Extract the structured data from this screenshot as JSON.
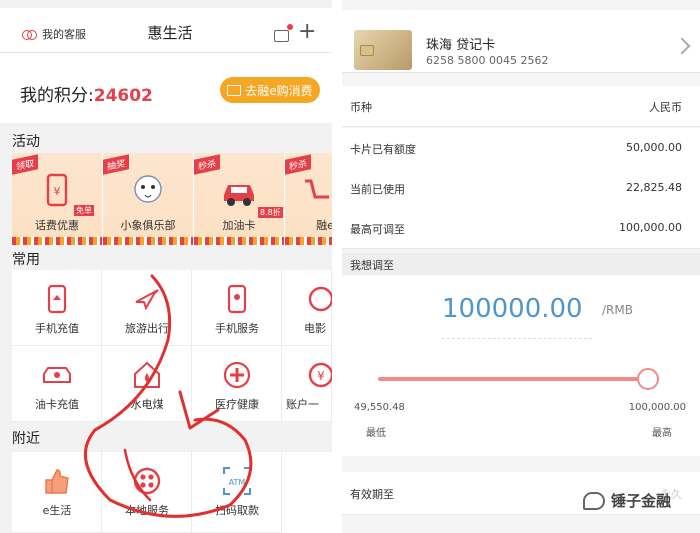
{
  "left": {
    "header": {
      "service": "我的客服",
      "title": "惠生活"
    },
    "points": {
      "label": "我的积分:",
      "value": "24602",
      "button": "去融e购消费"
    },
    "sections": {
      "activities": "活动",
      "common": "常用",
      "nearby": "附近"
    },
    "activities": [
      {
        "label": "话费优惠",
        "badge": "免单"
      },
      {
        "label": "小象俱乐部",
        "badge": ""
      },
      {
        "label": "加油卡",
        "badge": "8.8折"
      },
      {
        "label": "融e",
        "badge": ""
      }
    ],
    "common": [
      {
        "label": "手机充值",
        "icon": "phone-recharge-icon"
      },
      {
        "label": "旅游出行",
        "icon": "plane-icon"
      },
      {
        "label": "手机服务",
        "icon": "phone-service-icon"
      },
      {
        "label": "电影",
        "icon": "film-icon"
      },
      {
        "label": "油卡充值",
        "icon": "car-fuel-icon"
      },
      {
        "label": "水电煤",
        "icon": "home-utility-icon"
      },
      {
        "label": "医疗健康",
        "icon": "medical-icon"
      },
      {
        "label": "账户一",
        "icon": "account-icon"
      }
    ],
    "nearby": [
      {
        "label": "e生活",
        "icon": "thumbs-up-icon"
      },
      {
        "label": "本地服务",
        "icon": "local-service-icon"
      },
      {
        "label": "扫码取款",
        "icon": "atm-scan-icon",
        "tag": "ATM"
      }
    ]
  },
  "right": {
    "card": {
      "name": "珠海 贷记卡",
      "number": "6258 5800 0045 2562"
    },
    "rows": [
      {
        "key": "币种",
        "value": "人民币"
      },
      {
        "key": "卡片已有额度",
        "value": "50,000.00"
      },
      {
        "key": "当前已使用",
        "value": "22,825.48"
      },
      {
        "key": "最高可调至",
        "value": "100,000.00"
      }
    ],
    "adjust": {
      "heading": "我想调至",
      "amount": "100000.00",
      "unit": "/RMB",
      "min_value": "49,550.48",
      "max_value": "100,000.00",
      "min_label": "最低",
      "max_label": "最高",
      "slider_fraction": 1.0
    },
    "expiry": {
      "key": "有效期至",
      "value": "永久"
    }
  },
  "watermark": "锤子金融",
  "colors": {
    "accent": "#e5404a",
    "orange": "#f5a623",
    "blue": "#4f96c9",
    "slider": "#f08c8c"
  }
}
